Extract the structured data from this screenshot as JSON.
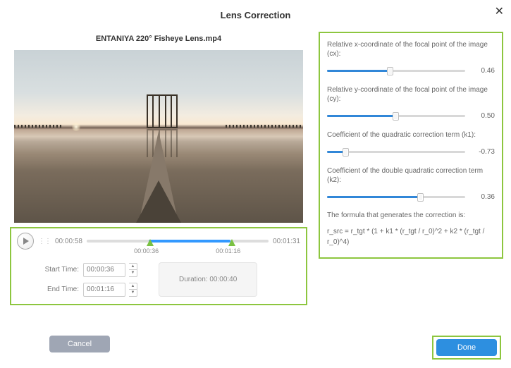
{
  "dialog": {
    "title": "Lens Correction"
  },
  "video": {
    "name": "ENTANIYA 220° Fisheye Lens.mp4",
    "current_time": "00:00:58",
    "total_time": "00:01:31",
    "range_start_disp": "00:00:36",
    "range_end_disp": "00:01:16"
  },
  "time": {
    "start_label": "Start Time:",
    "end_label": "End Time:",
    "start_value": "00:00:36",
    "end_value": "00:01:16",
    "duration_label": "Duration:  00:00:40"
  },
  "params": [
    {
      "label": "Relative x-coordinate of the focal point of the image (cx):",
      "value": "0.46",
      "fill": 46
    },
    {
      "label": "Relative y-coordinate of the focal point of the image (cy):",
      "value": "0.50",
      "fill": 50
    },
    {
      "label": "Coefficient of the quadratic correction term (k1):",
      "value": "-0.73",
      "fill": 14
    },
    {
      "label": "Coefficient of the double quadratic correction term (k2):",
      "value": "0.36",
      "fill": 68
    }
  ],
  "formula": {
    "intro": "The formula that generates the correction is:",
    "body": "r_src = r_tgt * (1 + k1 * (r_tgt / r_0)^2 + k2 * (r_tgt / r_0)^4)"
  },
  "buttons": {
    "cancel": "Cancel",
    "done": "Done"
  }
}
